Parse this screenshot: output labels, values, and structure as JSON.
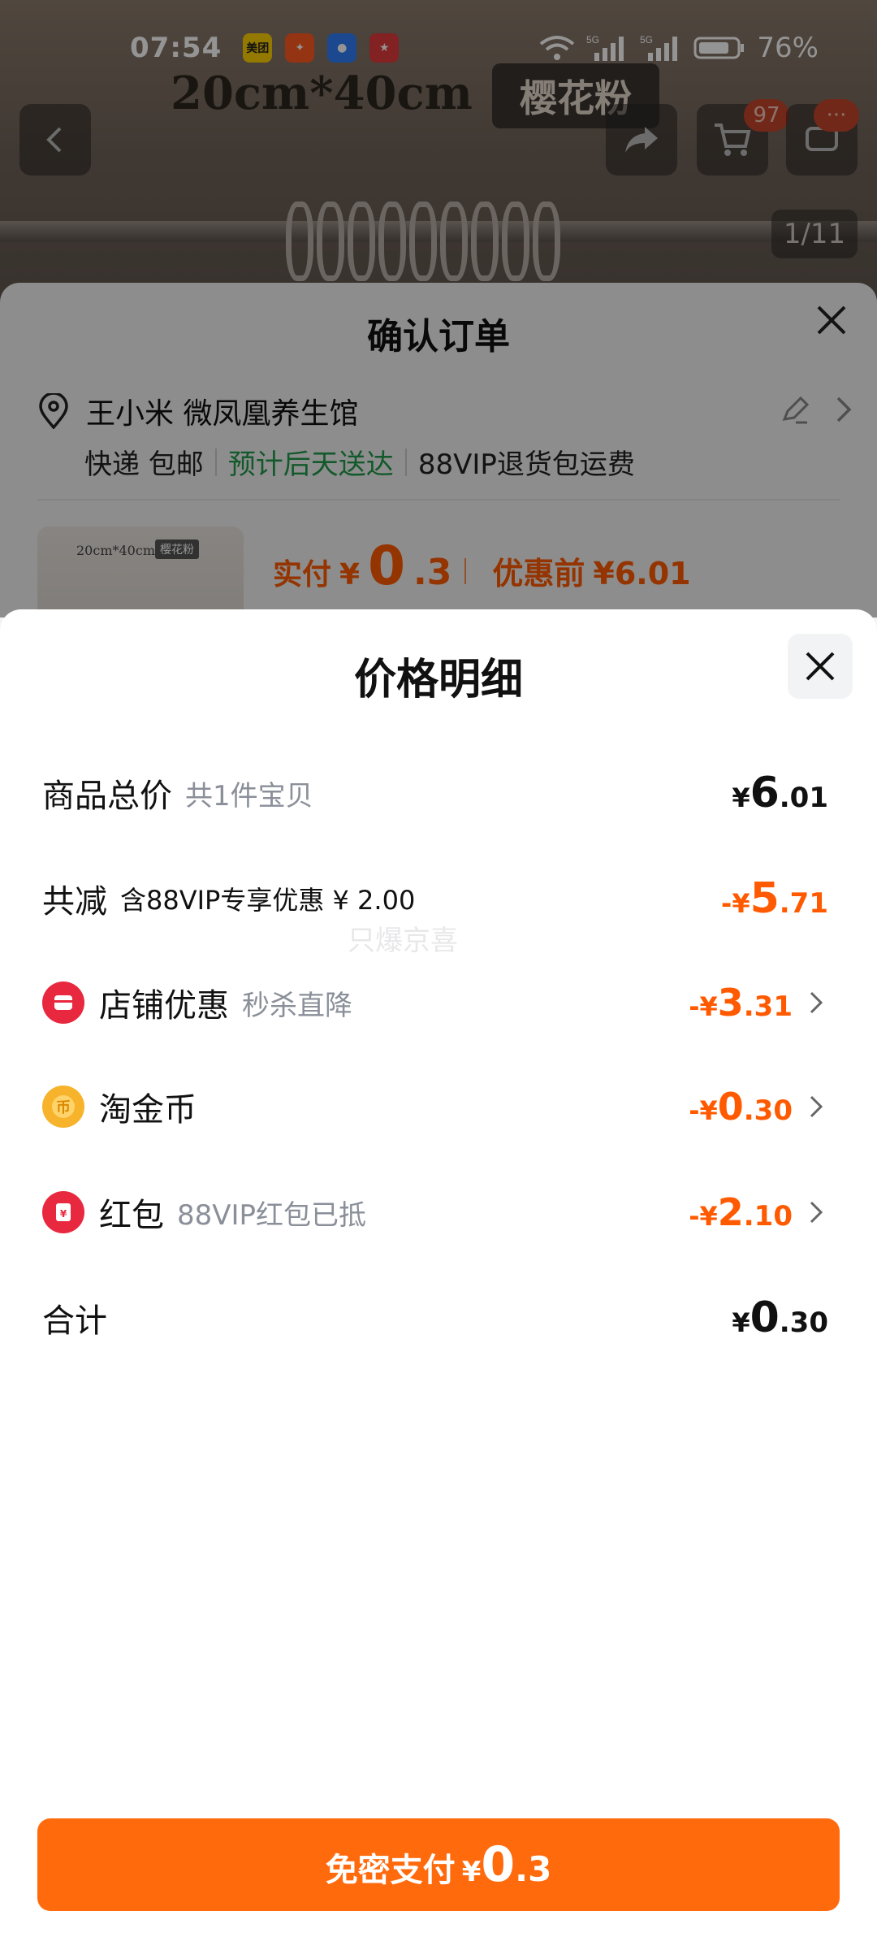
{
  "status_bar": {
    "time": "07:54",
    "apps": [
      {
        "name": "meituan-app-icon",
        "label": "美团",
        "bg": "#ffd100",
        "fg": "#222"
      },
      {
        "name": "kuaishou-app-icon",
        "label": "",
        "bg": "#ff5a1f",
        "fg": "#fff"
      },
      {
        "name": "search-app-icon",
        "label": "",
        "bg": "#2f7cf6",
        "fg": "#fff"
      },
      {
        "name": "game-app-icon",
        "label": "",
        "bg": "#e03b3b",
        "fg": "#fff"
      }
    ],
    "network": "5G",
    "battery": "76%"
  },
  "product_bg": {
    "caption": "20cm*40cm",
    "tag": "樱花粉",
    "cart_count": "97",
    "more_badge": "···",
    "pager": "1/11"
  },
  "order": {
    "title": "确认订单",
    "address_name": "王小米 微凤凰养生馆",
    "shipping": "快递 包邮",
    "delivery": "预计后天送达",
    "return_note": "88VIP退货包运费",
    "thumb_caption": "20cm*40cm",
    "thumb_tag": "樱花粉",
    "paid_label": "实付",
    "paid_currency": "¥",
    "paid_int": "0",
    "paid_dec": ".3",
    "before_label": "优惠前",
    "before_value": "¥6.01"
  },
  "price_detail": {
    "title": "价格明细",
    "rows": [
      {
        "name": "商品总价",
        "sub": "共1件宝贝",
        "cur": "¥",
        "int": "6",
        "dec": ".01",
        "sign": ""
      },
      {
        "name": "共减",
        "sub": "含88VIP专享优惠 ¥ 2.00",
        "cur": "¥",
        "int": "5",
        "dec": ".71",
        "sign": "-"
      },
      {
        "name": "店铺优惠",
        "sub": "秒杀直降",
        "cur": "¥",
        "int": "3",
        "dec": ".31",
        "sign": "-"
      },
      {
        "name": "淘金币",
        "sub": "",
        "cur": "¥",
        "int": "0",
        "dec": ".30",
        "sign": "-"
      },
      {
        "name": "红包",
        "sub": "88VIP红包已抵",
        "cur": "¥",
        "int": "2",
        "dec": ".10",
        "sign": "-"
      },
      {
        "name": "合计",
        "sub": "",
        "cur": "¥",
        "int": "0",
        "dec": ".30",
        "sign": ""
      }
    ],
    "watermark": "只爆京喜"
  },
  "pay_button": {
    "label": "免密支付",
    "cur": "¥",
    "int": "0",
    "dec": ".3"
  },
  "colors": {
    "accent": "#ff5a00",
    "button": "#ff6a0d",
    "green": "#1f9a4a"
  }
}
